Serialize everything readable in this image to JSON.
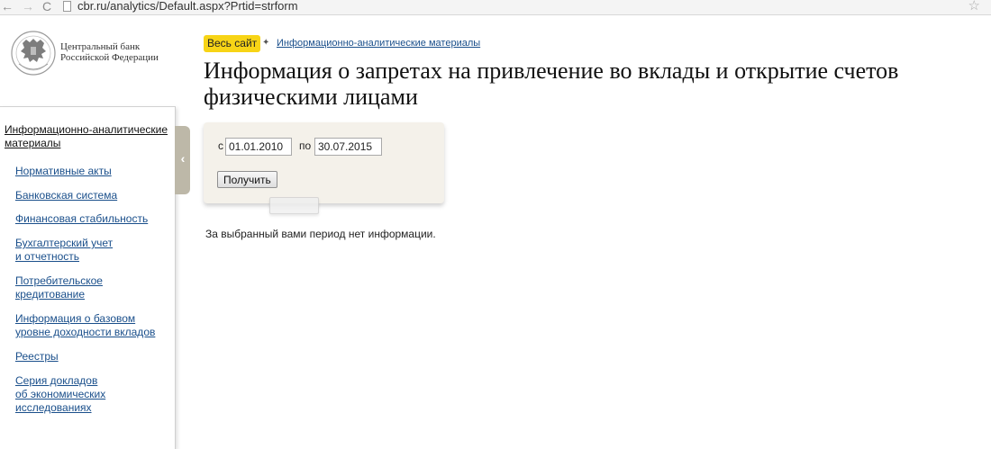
{
  "browser": {
    "url": "cbr.ru/analytics/Default.aspx?Prtid=strform",
    "back_glyph": "←",
    "forward_glyph": "→",
    "reload_glyph": "C",
    "bookmark_glyph": "☆"
  },
  "logo": {
    "line1": "Центральный банк",
    "line2": "Российской Федерации",
    "emblem_icon": "double-headed-eagle-icon"
  },
  "sidebar": {
    "header": "Информационно-аналитические материалы",
    "items": [
      {
        "label": "Нормативные акты"
      },
      {
        "label": "Банковская система"
      },
      {
        "label": "Финансовая стабильность"
      },
      {
        "label": "Бухгалтерский учет\nи отчетность"
      },
      {
        "label": "Потребительское\nкредитование"
      },
      {
        "label": "Информация о базовом\nуровне доходности вкладов"
      },
      {
        "label": "Реестры"
      },
      {
        "label": "Серия докладов\nоб экономических\nисследованиях"
      }
    ],
    "collapse_glyph": "‹"
  },
  "breadcrumb": {
    "home": "Весь сайт",
    "separator": "✦",
    "current": "Информационно-аналитические материалы"
  },
  "page": {
    "title": "Информация о запретах на привлечение во вклады и открытие счетов физическими лицами"
  },
  "form": {
    "from_label": "с",
    "from_value": "01.01.2010",
    "to_label": "по",
    "to_value": "30.07.2015",
    "submit_label": "Получить"
  },
  "result": {
    "message": "За выбранный вами период нет информации."
  },
  "colors": {
    "link": "#1a4f8b",
    "home_badge": "#f7d416",
    "panel_bg": "#f4f1ea",
    "collapse_tab": "#bdb8a8"
  }
}
